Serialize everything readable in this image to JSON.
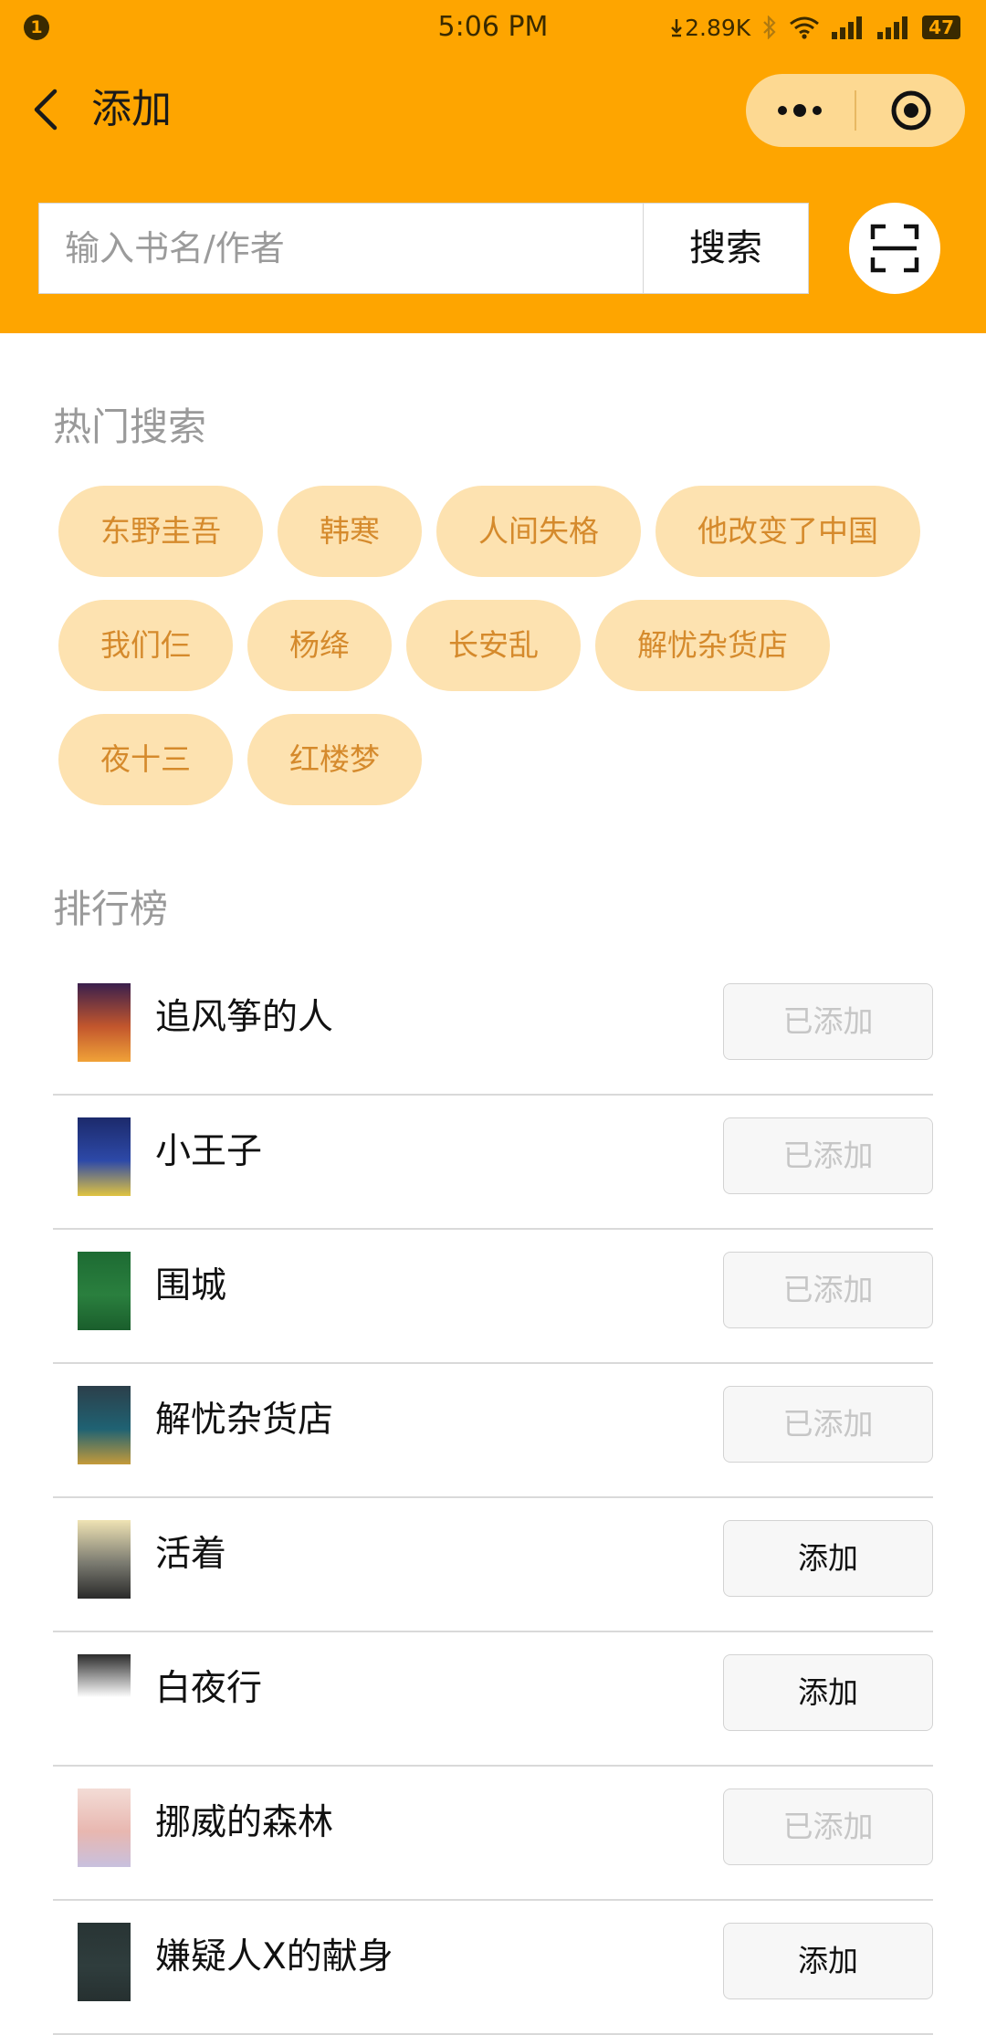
{
  "status_bar": {
    "notification_count": "1",
    "time": "5:06 PM",
    "net_speed": "2.89K",
    "battery": "47"
  },
  "nav": {
    "title": "添加"
  },
  "search": {
    "placeholder": "输入书名/作者",
    "button_label": "搜索"
  },
  "hot_search": {
    "title": "热门搜索",
    "rows": [
      [
        "东野圭吾",
        "韩寒",
        "人间失格",
        "他改变了中国"
      ],
      [
        "我们仨",
        "杨绛",
        "长安乱",
        "解忧杂货店"
      ],
      [
        "夜十三",
        "红楼梦"
      ]
    ]
  },
  "ranking": {
    "title": "排行榜",
    "items": [
      {
        "title": "追风筝的人",
        "button": "已添加",
        "added": true,
        "cover_colors": [
          "#3a1f4d",
          "#c2562d",
          "#f0a238"
        ]
      },
      {
        "title": "小王子",
        "button": "已添加",
        "added": true,
        "cover_colors": [
          "#1c2a6b",
          "#2d49a8",
          "#e0c440"
        ]
      },
      {
        "title": "围城",
        "button": "已添加",
        "added": true,
        "cover_colors": [
          "#1d6b33",
          "#2a7f3e",
          "#1a5e2c"
        ]
      },
      {
        "title": "解忧杂货店",
        "button": "已添加",
        "added": true,
        "cover_colors": [
          "#2c3f4a",
          "#1f6273",
          "#c49a3a"
        ]
      },
      {
        "title": "活着",
        "button": "添加",
        "added": false,
        "cover_colors": [
          "#efe3b4",
          "#7a7a70",
          "#2a2a2a"
        ]
      },
      {
        "title": "白夜行",
        "button": "添加",
        "added": false,
        "cover_colors": [
          "#2b2b2b",
          "#ffffff",
          "#ffffff"
        ]
      },
      {
        "title": "挪威的森林",
        "button": "已添加",
        "added": true,
        "cover_colors": [
          "#f3dcd6",
          "#e8b7b0",
          "#c8c0de"
        ]
      },
      {
        "title": "嫌疑人X的献身",
        "button": "添加",
        "added": false,
        "cover_colors": [
          "#283434",
          "#2f3d3d",
          "#263030"
        ]
      }
    ]
  }
}
